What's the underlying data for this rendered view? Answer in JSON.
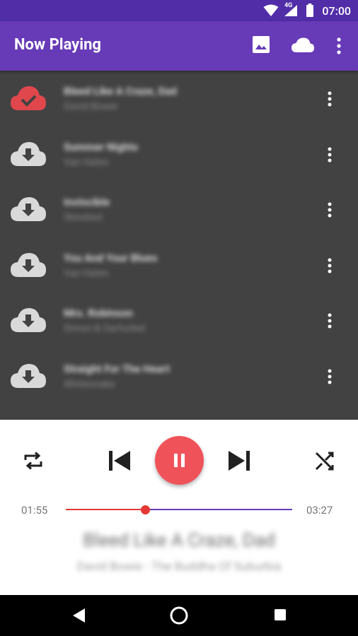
{
  "status_bar": {
    "time": "07:00",
    "network": "4G"
  },
  "app_bar": {
    "title": "Now Playing"
  },
  "tracks": [
    {
      "title": "Bleed Like A Craze, Dad",
      "artist": "David Bowie",
      "cloud_state": "downloaded",
      "color": "#e0474c"
    },
    {
      "title": "Summer Nights",
      "artist": "Van Halen",
      "cloud_state": "download",
      "color": "#d9d9d9"
    },
    {
      "title": "Invincible",
      "artist": "Skindred",
      "cloud_state": "download",
      "color": "#d9d9d9"
    },
    {
      "title": "You And Your Blues",
      "artist": "Van Halen",
      "cloud_state": "download",
      "color": "#d9d9d9"
    },
    {
      "title": "Mrs. Robinson",
      "artist": "Simon & Garfunkel",
      "cloud_state": "download",
      "color": "#d9d9d9"
    },
    {
      "title": "Straight For The Heart",
      "artist": "Whitesnake",
      "cloud_state": "download",
      "color": "#d9d9d9"
    }
  ],
  "player": {
    "elapsed": "01:55",
    "duration": "03:27",
    "progress": 0.35,
    "now_playing_title": "Bleed Like A Craze, Dad",
    "now_playing_subtitle": "David Bowie - The Buddha Of Suburbia",
    "accent": "#f0525a",
    "progress_color": "#e53935",
    "remaining_color": "#673ab7"
  },
  "colors": {
    "primary": "#673ab7",
    "primary_dark": "#512da8",
    "list_bg": "#424242"
  }
}
